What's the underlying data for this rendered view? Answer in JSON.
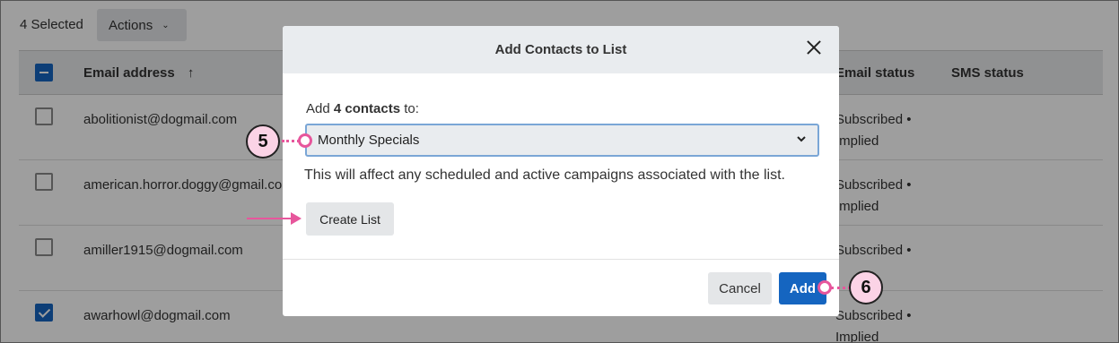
{
  "page": {
    "selected_count": "4 Selected",
    "actions_label": "Actions",
    "columns": {
      "email": "Email address",
      "email_status": "Email status",
      "sms_status": "SMS status"
    },
    "rows": [
      {
        "email": "abolitionist@dogmail.com",
        "status": "Subscribed • Implied",
        "checked": false
      },
      {
        "email": "american.horror.doggy@gmail.com",
        "status": "Subscribed • Implied",
        "checked": false
      },
      {
        "email": "amiller1915@dogmail.com",
        "status": "Subscribed •",
        "checked": false
      },
      {
        "email": "awarhowl@dogmail.com",
        "status": "Subscribed • Implied",
        "checked": true
      }
    ]
  },
  "modal": {
    "title": "Add Contacts to List",
    "prompt_prefix": "Add ",
    "prompt_bold": "4 contacts",
    "prompt_suffix": " to:",
    "selected_list": "Monthly Specials",
    "note": "This will affect any scheduled and active campaigns associated with the list.",
    "create_list_label": "Create List",
    "cancel_label": "Cancel",
    "add_label": "Add"
  },
  "callouts": {
    "step5": "5",
    "step6": "6"
  },
  "colors": {
    "accent": "#1565c0",
    "callout": "#e7569c",
    "callout_fill": "#fbd3e6"
  }
}
